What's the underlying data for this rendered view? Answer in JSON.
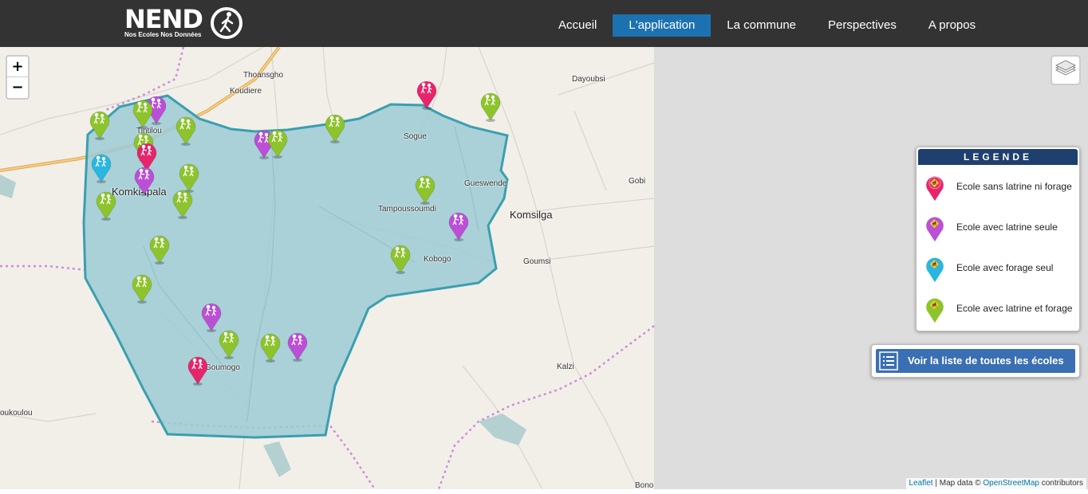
{
  "header": {
    "logo": {
      "word": "NEND",
      "tagline": "Nos Ecoles Nos Données"
    },
    "nav": [
      {
        "label": "Accueil",
        "active": false
      },
      {
        "label": "L'application",
        "active": true
      },
      {
        "label": "La commune",
        "active": false
      },
      {
        "label": "Perspectives",
        "active": false
      },
      {
        "label": "A propos",
        "active": false
      }
    ],
    "colors": {
      "bar": "#333333",
      "active": "#1c72b1"
    }
  },
  "map": {
    "zoom_in": "+",
    "zoom_out": "−",
    "places": [
      {
        "name": "Thoansgho",
        "big": false
      },
      {
        "name": "Koudiere",
        "big": false
      },
      {
        "name": "Dayoubsi",
        "big": false
      },
      {
        "name": "Tintilou",
        "big": false
      },
      {
        "name": "Sogue",
        "big": false
      },
      {
        "name": "Komki-Ipala",
        "big": true
      },
      {
        "name": "Gueswende",
        "big": false
      },
      {
        "name": "Gobi",
        "big": false
      },
      {
        "name": "Tampoussoumdi",
        "big": false
      },
      {
        "name": "Komsilga",
        "big": true
      },
      {
        "name": "Kobogo",
        "big": false
      },
      {
        "name": "Goumsi",
        "big": false
      },
      {
        "name": "Kalzi",
        "big": false
      },
      {
        "name": "Goumogo",
        "big": false
      },
      {
        "name": "oukoulou",
        "big": false
      },
      {
        "name": "Bono",
        "big": false
      }
    ],
    "colors": {
      "commune_fill": "#9ccbd4",
      "commune_border": "#3a9fb0",
      "land": "#f2efe9",
      "outside": "#dddddd"
    }
  },
  "legend": {
    "title": "LEGENDE",
    "items": [
      {
        "label": "Ecole sans latrine ni forage",
        "color": "#e8246a"
      },
      {
        "label": "Ecole avec latrine seule",
        "color": "#bb4fd6"
      },
      {
        "label": "Ecole avec forage seul",
        "color": "#29b6e0"
      },
      {
        "label": "Ecole avec latrine et forage",
        "color": "#8dc42c"
      }
    ]
  },
  "list_button": {
    "label": "Voir la liste de toutes les écoles",
    "icon": "list-icon"
  },
  "attribution": {
    "leaflet": "Leaflet",
    "data": " | Map data © ",
    "osm": "OpenStreetMap",
    "contrib": " contributors"
  }
}
